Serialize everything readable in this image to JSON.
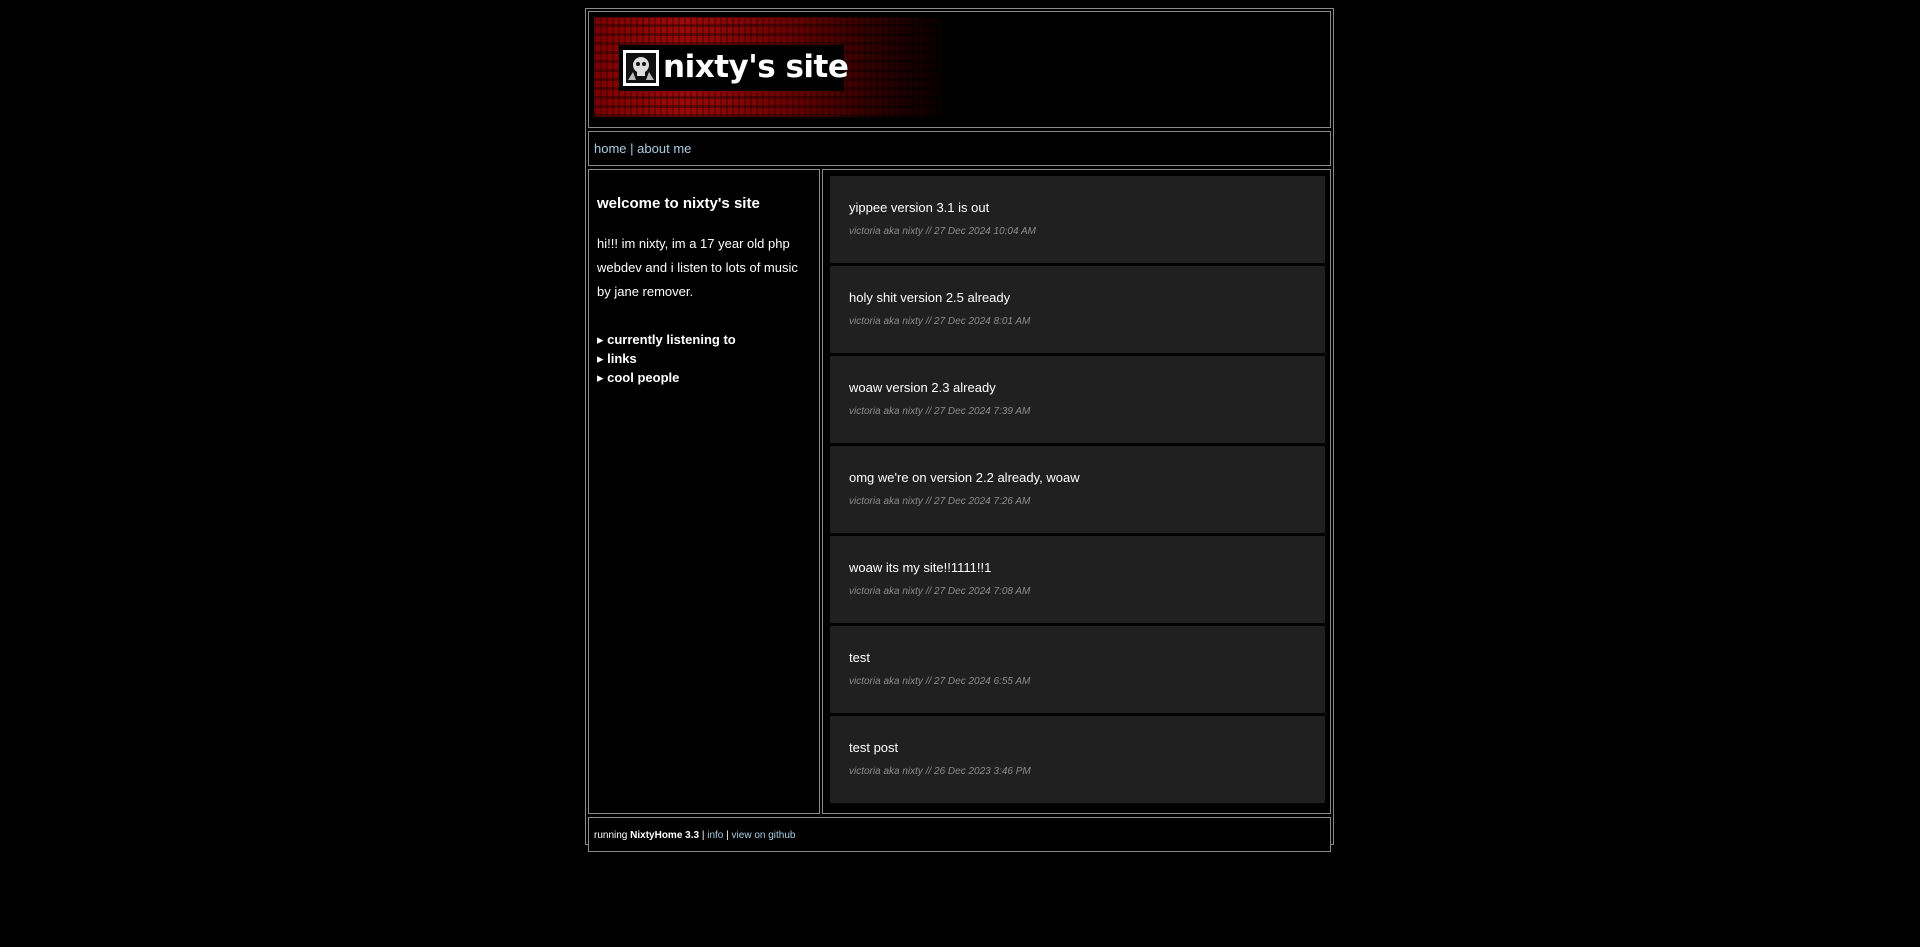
{
  "header": {
    "site_title": "nixty's site",
    "logo_icon": "skull-logo-icon"
  },
  "nav": {
    "home": "home",
    "separator": "|",
    "about": "about me"
  },
  "sidebar": {
    "title": "welcome to nixty's site",
    "intro": "hi!!! im nixty, im a 17 year old php webdev and i listen to lots of music by jane remover.",
    "links": [
      {
        "label": "▸ currently listening to"
      },
      {
        "label": "▸ links"
      },
      {
        "label": "▸ cool people"
      }
    ]
  },
  "posts": [
    {
      "title": "yippee version 3.1 is out",
      "meta": "victoria aka nixty // 27 Dec 2024 10:04 AM"
    },
    {
      "title": "holy shit version 2.5 already",
      "meta": "victoria aka nixty // 27 Dec 2024 8:01 AM"
    },
    {
      "title": "woaw version 2.3 already",
      "meta": "victoria aka nixty // 27 Dec 2024 7:39 AM"
    },
    {
      "title": "omg we're on version 2.2 already, woaw",
      "meta": "victoria aka nixty // 27 Dec 2024 7:26 AM"
    },
    {
      "title": "woaw its my site!!1111!!1",
      "meta": "victoria aka nixty // 27 Dec 2024 7:08 AM"
    },
    {
      "title": "test",
      "meta": "victoria aka nixty // 27 Dec 2024 6:55 AM"
    },
    {
      "title": "test post",
      "meta": "victoria aka nixty // 26 Dec 2023 3:46 PM"
    }
  ],
  "footer": {
    "running": "running",
    "app_name": "NixtyHome 3.3",
    "sep1": "|",
    "info": "info",
    "sep2": "|",
    "github": "view on github"
  },
  "colors": {
    "background": "#000000",
    "border": "#8a8a8a",
    "post_bg": "#202020",
    "link": "#a9cde0",
    "meta": "#8c8c8c",
    "banner_red": "#9c0a0a"
  }
}
